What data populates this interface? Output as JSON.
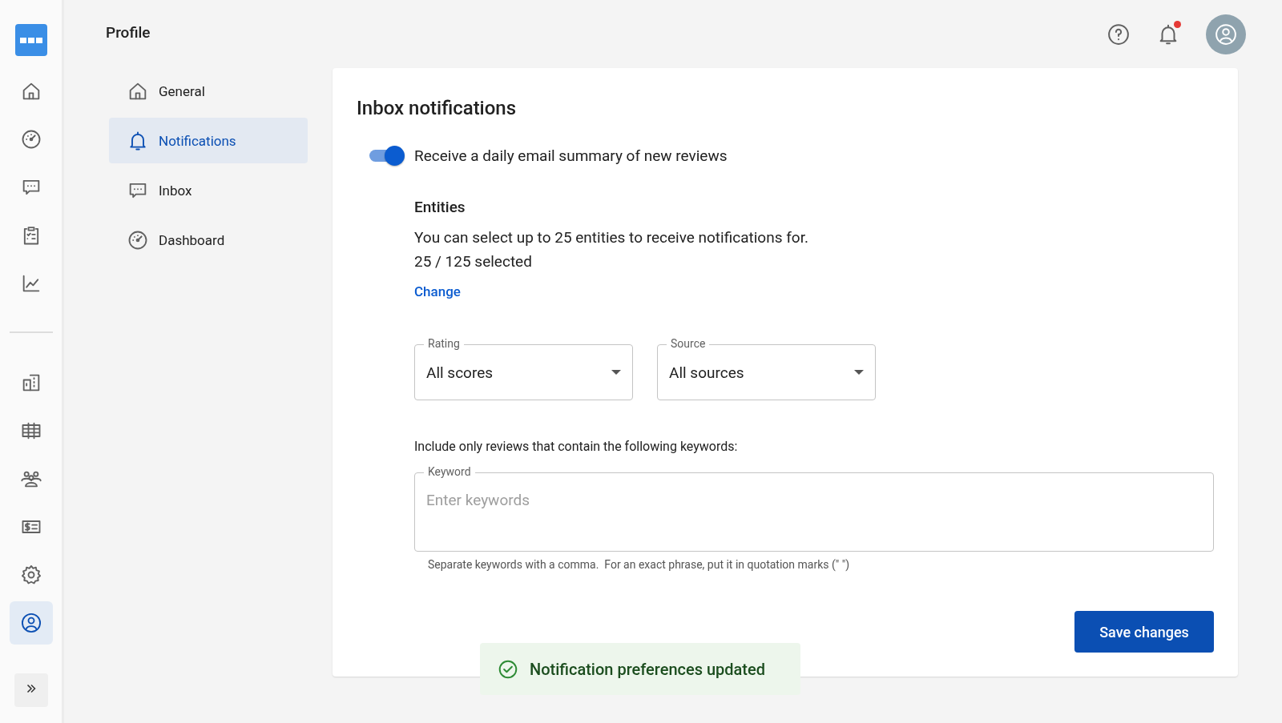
{
  "page_title": "Profile",
  "rail": {
    "top": [
      {
        "kind": "home",
        "selected": false
      },
      {
        "kind": "gauge",
        "selected": false
      },
      {
        "kind": "chat",
        "selected": false
      },
      {
        "kind": "clipboard",
        "selected": false
      },
      {
        "kind": "chart",
        "selected": false
      }
    ],
    "bottom": [
      {
        "kind": "building",
        "selected": false
      },
      {
        "kind": "table",
        "selected": false
      },
      {
        "kind": "people",
        "selected": false
      },
      {
        "kind": "billing",
        "selected": false
      },
      {
        "kind": "gear",
        "selected": false
      },
      {
        "kind": "user",
        "selected": true
      }
    ]
  },
  "header": {
    "notification_badge": true
  },
  "subnav": [
    {
      "label": "General",
      "kind": "home",
      "selected": false
    },
    {
      "label": "Notifications",
      "kind": "bell",
      "selected": true
    },
    {
      "label": "Inbox",
      "kind": "chat",
      "selected": false
    },
    {
      "label": "Dashboard",
      "kind": "gauge",
      "selected": false
    }
  ],
  "card": {
    "title": "Inbox notifications",
    "toggle": {
      "label": "Receive a daily email summary of new reviews",
      "on": true
    },
    "entities": {
      "heading": "Entities",
      "description": "You can select up to 25 entities to receive notifications for.",
      "count": "25 / 125 selected",
      "link": "Change"
    },
    "selects": [
      {
        "label": "Rating",
        "value": "All scores"
      },
      {
        "label": "Source",
        "value": "All sources"
      }
    ],
    "keywords": {
      "prompt": "Include only reviews that contain the following keywords:",
      "label": "Keyword",
      "placeholder": "Enter keywords",
      "helper": "Separate keywords with a comma.  For an exact phrase, put it in quotation marks (\" \")"
    },
    "save_button": "Save changes"
  },
  "toast": {
    "message": "Notification preferences updated"
  }
}
